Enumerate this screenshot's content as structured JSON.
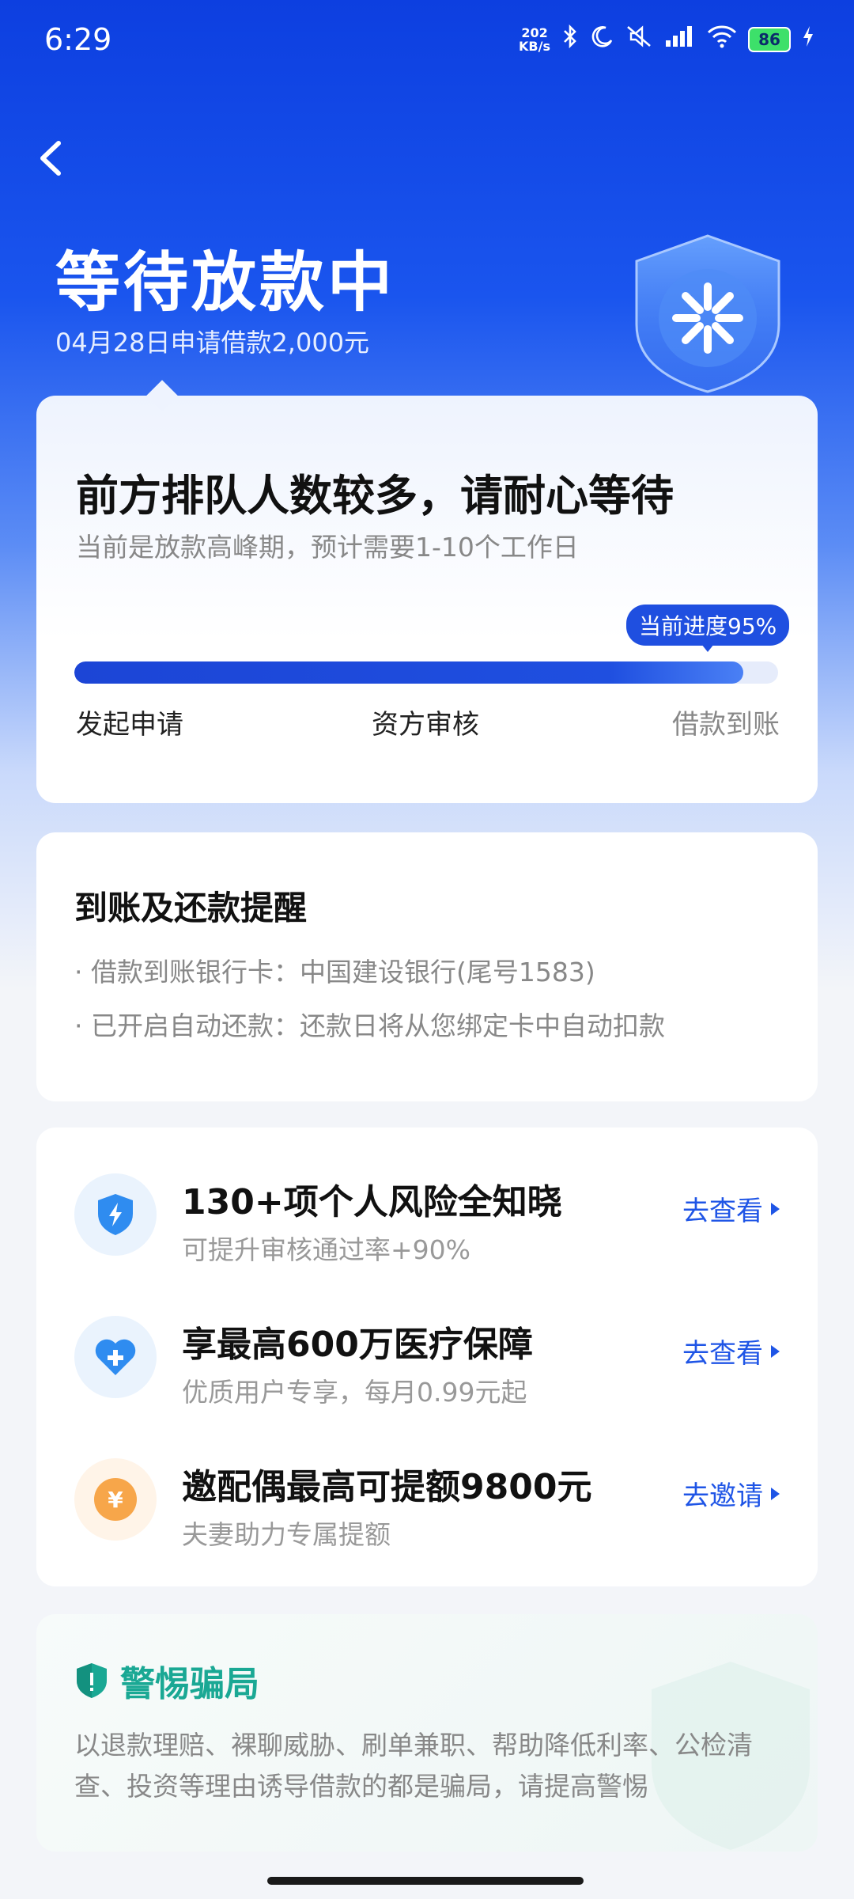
{
  "status_bar": {
    "time": "6:29",
    "speed_value": "202",
    "speed_unit": "KB/s",
    "battery": "86"
  },
  "header": {
    "title": "等待放款中",
    "subtitle": "04月28日申请借款2,000元"
  },
  "progress_card": {
    "title": "前方排队人数较多，请耐心等待",
    "subtitle": "当前是放款高峰期，预计需要1-10个工作日",
    "progress_label": "当前进度95%",
    "progress": 0.95,
    "steps": [
      "发起申请",
      "资方审核",
      "借款到账"
    ]
  },
  "reminder_card": {
    "title": "到账及还款提醒",
    "lines": [
      "· 借款到账银行卡：中国建设银行(尾号1583)",
      "· 已开启自动还款：还款日将从您绑定卡中自动扣款"
    ]
  },
  "promo_card": {
    "items": [
      {
        "title": "130+项个人风险全知晓",
        "subtitle": "可提升审核通过率+90%",
        "action": "去查看",
        "icon": "shield-lightning-icon"
      },
      {
        "title": "享最高600万医疗保障",
        "subtitle": "优质用户专享，每月0.99元起",
        "action": "去查看",
        "icon": "heart-plus-icon"
      },
      {
        "title": "邀配偶最高可提额9800元",
        "subtitle": "夫妻助力专属提额",
        "action": "去邀请",
        "icon": "yuan-coin-icon"
      }
    ]
  },
  "warning_card": {
    "title": "警惕骗局",
    "text": "以退款理赔、裸聊威胁、刷单兼职、帮助降低利率、公检清查、投资等理由诱导借款的都是骗局，请提高警惕"
  },
  "colors": {
    "brand_blue": "#1f4fe0",
    "warn_green": "#1aa894",
    "heart_blue": "#2f8cf0",
    "coin_orange": "#f7a64a"
  }
}
